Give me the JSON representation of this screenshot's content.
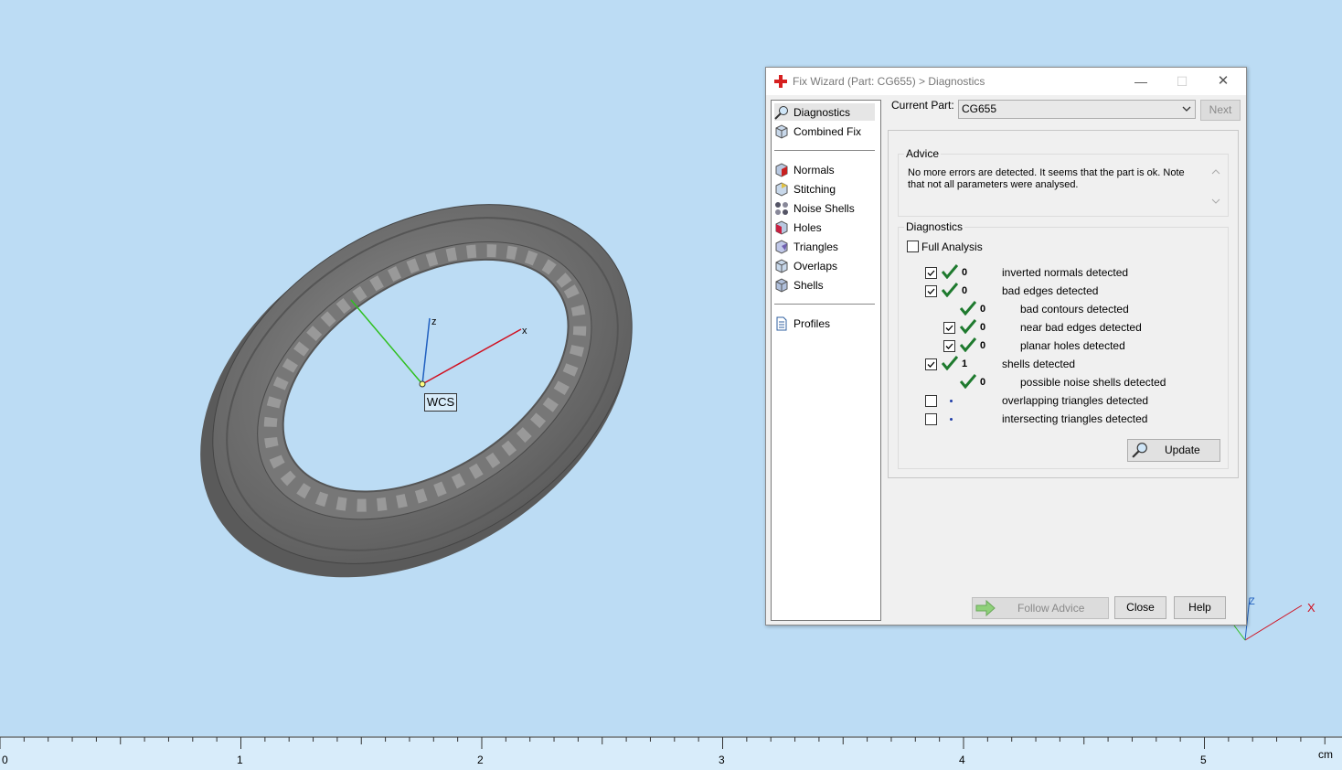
{
  "dialog": {
    "title": "Fix Wizard (Part: CG655) > Diagnostics",
    "minimize": "—",
    "maximize": "☐",
    "close": "✕"
  },
  "nav": {
    "items": [
      {
        "label": "Diagnostics",
        "icon": "magnifier-icon",
        "selected": true
      },
      {
        "label": "Combined Fix",
        "icon": "cube-icon"
      },
      {
        "label": "Normals",
        "icon": "cube-normals-icon"
      },
      {
        "label": "Stitching",
        "icon": "cube-stitching-icon"
      },
      {
        "label": "Noise Shells",
        "icon": "noise-shells-icon"
      },
      {
        "label": "Holes",
        "icon": "cube-holes-icon"
      },
      {
        "label": "Triangles",
        "icon": "cube-triangles-icon"
      },
      {
        "label": "Overlaps",
        "icon": "cube-overlaps-icon"
      },
      {
        "label": "Shells",
        "icon": "cube-shells-icon"
      },
      {
        "label": "Profiles",
        "icon": "document-icon"
      }
    ]
  },
  "header": {
    "current_part_label": "Current Part:",
    "current_part_value": "CG655",
    "next_label": "Next"
  },
  "advice": {
    "title": "Advice",
    "text": "No more errors are detected. It seems that the part is ok. Note that not all parameters were analysed."
  },
  "diagnostics": {
    "title": "Diagnostics",
    "full_analysis_label": "Full Analysis",
    "rows": [
      {
        "label": "inverted normals detected",
        "value": "0",
        "checked": true,
        "status": "ok"
      },
      {
        "label": "bad edges detected",
        "value": "0",
        "checked": true,
        "status": "ok"
      },
      {
        "label": "bad contours detected",
        "value": "0",
        "checked": null,
        "status": "ok"
      },
      {
        "label": "near bad edges detected",
        "value": "0",
        "checked": true,
        "status": "ok"
      },
      {
        "label": "planar holes detected",
        "value": "0",
        "checked": true,
        "status": "ok"
      },
      {
        "label": "shells detected",
        "value": "1",
        "checked": true,
        "status": "ok"
      },
      {
        "label": "possible noise shells detected",
        "value": "0",
        "checked": null,
        "status": "ok"
      },
      {
        "label": "overlapping triangles detected",
        "value": "",
        "checked": false,
        "status": "pending"
      },
      {
        "label": "intersecting triangles detected",
        "value": "",
        "checked": false,
        "status": "pending"
      }
    ],
    "update_label": "Update"
  },
  "footer": {
    "follow_advice_label": "Follow Advice",
    "close_label": "Close",
    "help_label": "Help"
  },
  "viewport": {
    "wcs_label": "WCS",
    "axis_z": "z",
    "axis_x": "x",
    "corner_z": "Z",
    "corner_x": "X"
  },
  "ruler": {
    "labels": [
      "0",
      "1",
      "2",
      "3",
      "4",
      "5"
    ],
    "unit": "cm"
  },
  "colors": {
    "background": "#bcdcf4",
    "ring": "#6e6e6e",
    "check_green": "#1e7a2e",
    "axis_x": "#d01020",
    "axis_y": "#30c020",
    "axis_z": "#2060c0"
  }
}
